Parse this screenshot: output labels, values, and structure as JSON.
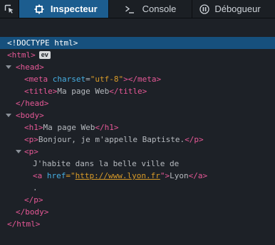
{
  "toolbar": {
    "picker_icon": "element-picker-icon",
    "tabs": [
      {
        "label": "Inspecteur",
        "icon": "inspector-icon",
        "selected": true
      },
      {
        "label": "Console",
        "icon": "console-prompt-icon",
        "selected": false
      },
      {
        "label": "Débogueur",
        "icon": "pause-icon",
        "selected": false
      }
    ]
  },
  "colors": {
    "background": "#1d2127",
    "selected_tab": "#1c5d8f",
    "selected_row": "#16507d",
    "tag": "#e65896",
    "attribute_name": "#46afe3",
    "attribute_value": "#d99b28",
    "text": "#b6babf"
  },
  "markup": {
    "doctype": "<!DOCTYPE html>",
    "html_open": "<html>",
    "event_badge": "ev",
    "head_open": "<head>",
    "meta_open": "<meta",
    "meta_attr_name": "charset",
    "meta_attr_value": "\"utf-8\"",
    "meta_close": "></meta>",
    "title_open": "<title>",
    "title_text": "Ma page Web",
    "title_close": "</title>",
    "head_close": "</head>",
    "body_open": "<body>",
    "h1_open": "<h1>",
    "h1_text": "Ma page Web",
    "h1_close": "</h1>",
    "p1_open": "<p>",
    "p1_text": "Bonjour, je m'appelle Baptiste.",
    "p1_close": "</p>",
    "p2_open": "<p>",
    "p2_text": "J'habite dans la belle ville de",
    "a_open": "<a",
    "a_attr_name": "href",
    "a_attr_eq": "=\"",
    "a_attr_value": "http://www.lyon.fr",
    "a_attr_end": "\">",
    "a_text": "Lyon",
    "a_close": "</a>",
    "p2_tail": ".",
    "p2_close": "</p>",
    "body_close": "</body>",
    "html_close": "</html>"
  }
}
